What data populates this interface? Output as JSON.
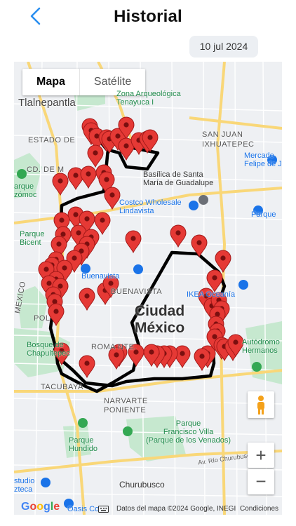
{
  "header": {
    "title": "Historial",
    "back_icon": "chevron-left-icon"
  },
  "date_chip": "10 jul 2024",
  "map_type": {
    "map_label": "Mapa",
    "satellite_label": "Satélite"
  },
  "map_labels": {
    "tlalnepantla": "Tlalnepantla",
    "zona_arq": "Zona Arqueológica\nTenayuca I",
    "san_juan": "SAN JUAN\nIXHUATEPEC",
    "mercado": "Mercado\nFelipe de J",
    "estado_de": "ESTADO DE",
    "cd_de_m": "CD. DE M",
    "basilica": "Basílica de Santa\nMaría de Guadalupe",
    "parque_zozomoc": "arque\nzómoc",
    "costco": "Costco Wholesale\nLindavista",
    "parque_right": "Parque",
    "parque_bicent": "Parque\nBicent",
    "mexico_vertical": "MEXICO",
    "buenavista_poi": "Buenavista",
    "buenavista": "BUENAVISTA",
    "ikea": "IKEA Oceanía",
    "polanco": "POL",
    "ciudad": "Ciudad\nMéxico",
    "bosque": "Bosque de\nChapultepec",
    "roma": "ROMA NTE.",
    "autodromo": "Autódromo\nHermanos",
    "tacubaya": "TACUBAYA",
    "narvarte": "NARVARTE\nPONIENTE",
    "parque_hundido": "Parque\nHundido",
    "parque_fv": "Parque\nFrancisco Villa\n(Parque de los Venados)",
    "churubusco": "Churubusco",
    "av_churubusco": "Av. Río Churubusco",
    "studio": "studio\nzteca",
    "oasis": "Oasis Co"
  },
  "controls": {
    "zoom_in": "+",
    "zoom_out": "−",
    "pegman_icon": "pegman-icon"
  },
  "footer": {
    "google": "Google",
    "attribution": "Datos del mapa ©2024 Google, INEGI",
    "terms": "Condiciones"
  },
  "colors": {
    "marker": "#e53935",
    "route": "#000000",
    "back": "#2b8ff0",
    "park": "#c6e8cf",
    "road": "#ffffff",
    "highway": "#f9d778"
  }
}
